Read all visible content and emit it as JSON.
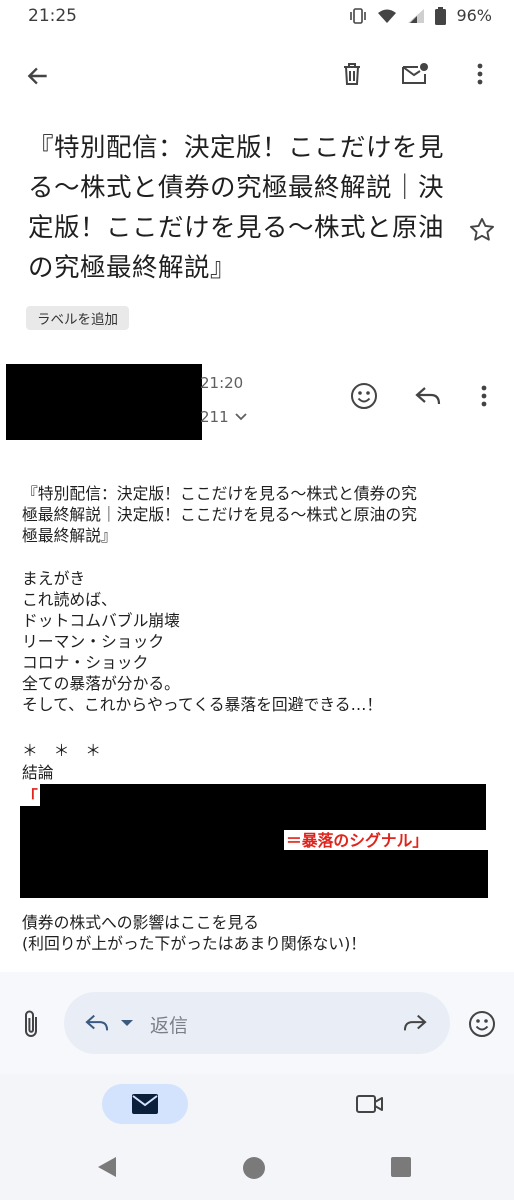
{
  "status_bar": {
    "time": "21:25",
    "battery": "96%"
  },
  "toolbar": {
    "icons": [
      "back-arrow-icon",
      "trash-icon",
      "mark-unread-icon",
      "more-vert-icon"
    ]
  },
  "email": {
    "subject": "『特別配信：決定版！ここだけを見る〜株式と債券の究極最終解説｜決定版！ここだけを見る〜株式と原油の究極最終解説』",
    "label_chip": "ラベルを追加",
    "sender_time": "21:20",
    "recipient_fragment": "211"
  },
  "body": {
    "para1": "『特別配信：決定版！ここだけを見る〜株式と債券の究\n極最終解説｜決定版！ここだけを見る〜株式と原油の究\n極最終解説』",
    "para2": "まえがき\nこれ読めば、\nドットコムバブル崩壊\nリーマン・ショック\nコロナ・ショック\n全ての暴落が分かる。\nそして、これからやってくる暴落を回避できる…！",
    "stars": "＊　＊　＊",
    "conclusion_label": "結論",
    "bracket_open": "「",
    "red_tail": "＝暴落のシグナル」",
    "para3": "債券の株式への影響はここを見る\n(利回りが上がった下がったはあまり関係ない)！"
  },
  "reply_bar": {
    "placeholder": "返信"
  },
  "colors": {
    "accent_red": "#e0241b",
    "nav_pill": "#d3e3fd",
    "reply_pill": "#e9eef6"
  }
}
